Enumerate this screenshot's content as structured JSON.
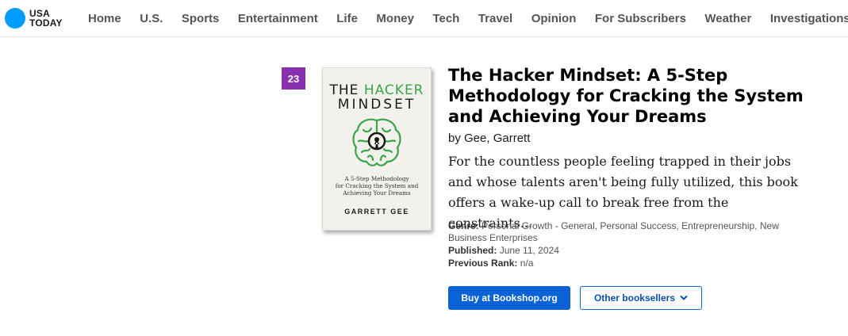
{
  "logo": {
    "line1": "USA",
    "line2": "TODAY",
    "brand_color": "#009bff"
  },
  "nav": {
    "items": [
      {
        "label": "Home"
      },
      {
        "label": "U.S."
      },
      {
        "label": "Sports"
      },
      {
        "label": "Entertainment"
      },
      {
        "label": "Life"
      },
      {
        "label": "Money"
      },
      {
        "label": "Tech"
      },
      {
        "label": "Travel"
      },
      {
        "label": "Opinion"
      },
      {
        "label": "For Subscribers"
      },
      {
        "label": "Weather"
      },
      {
        "label": "Investigations"
      }
    ]
  },
  "book": {
    "rank": "23",
    "rank_color": "#8a2fb0",
    "cover": {
      "title_part1": "THE ",
      "title_part2": "HACKER",
      "title_line2": "MINDSET",
      "subtitle_line1": "A 5-Step Methodology",
      "subtitle_line2": "for Cracking the System and",
      "subtitle_line3": "Achieving Your Dreams",
      "author": "GARRETT GEE",
      "icon": "brain-keyhole-icon"
    },
    "title": "The Hacker Mindset: A 5-Step Methodology for Cracking the System and Achieving Your Dreams",
    "author": "by Gee, Garrett",
    "description": "For the countless people feeling trapped in their jobs and whose talents aren't being fully utilized, this book offers a wake-up call to break free from the constraints...",
    "genre_label": "Genre:",
    "genre": "Personal Growth - General, Personal Success, Entrepreneurship, New Business Enterprises",
    "published_label": "Published:",
    "published": "June 11, 2024",
    "previous_rank_label": "Previous Rank:",
    "previous_rank": "n/a"
  },
  "buttons": {
    "buy": "Buy at Bookshop.org",
    "other": "Other booksellers",
    "accent_color": "#0a63d6"
  }
}
